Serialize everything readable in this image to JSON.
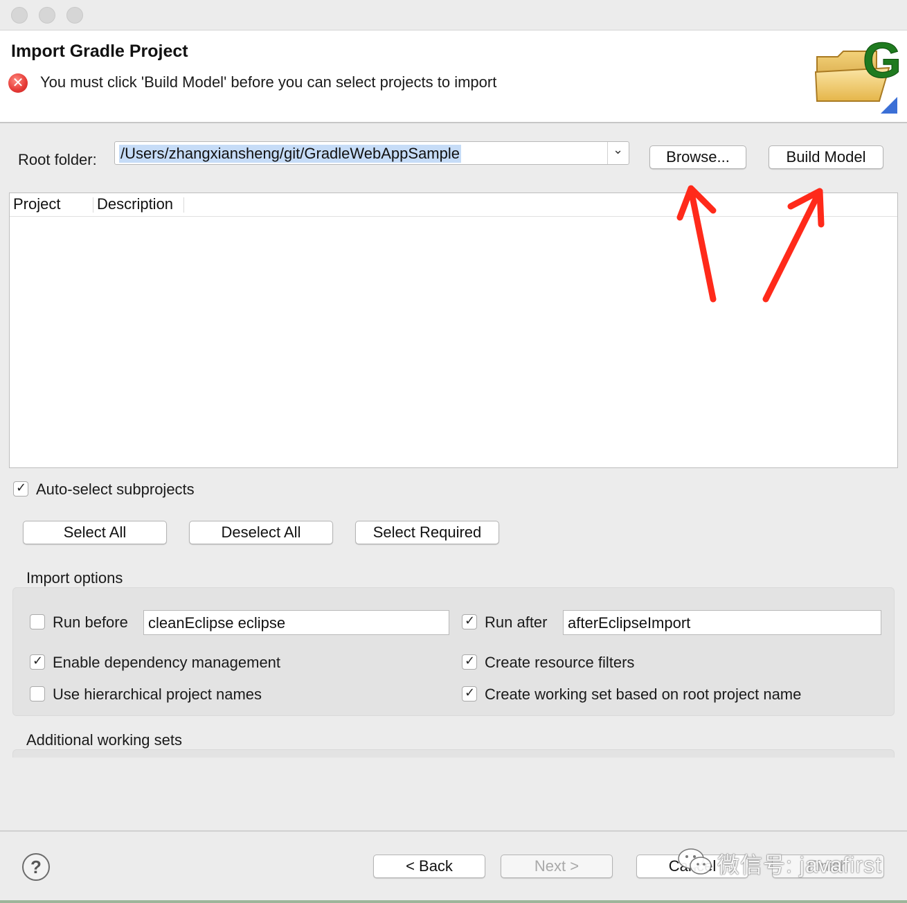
{
  "window": {
    "traffic_lights": [
      "close",
      "minimize",
      "zoom"
    ]
  },
  "header": {
    "title": "Import Gradle Project",
    "error_message": "You must click 'Build Model' before you can select projects to import",
    "wizard_icon_letter": "G"
  },
  "root_folder": {
    "label": "Root folder:",
    "value": "/Users/zhangxiansheng/git/GradleWebAppSample",
    "browse_label": "Browse...",
    "build_model_label": "Build Model"
  },
  "table": {
    "columns": [
      "Project",
      "Description"
    ],
    "rows": []
  },
  "auto_select": {
    "label": "Auto-select subprojects",
    "checked": true
  },
  "selection_buttons": {
    "select_all": "Select All",
    "deselect_all": "Deselect All",
    "select_required": "Select Required"
  },
  "import_options": {
    "title": "Import options",
    "run_before": {
      "label": "Run before",
      "checked": false,
      "value": "cleanEclipse eclipse"
    },
    "run_after": {
      "label": "Run after",
      "checked": true,
      "value": "afterEclipseImport"
    },
    "enable_dependency": {
      "label": "Enable dependency management",
      "checked": true
    },
    "resource_filters": {
      "label": "Create resource filters",
      "checked": true
    },
    "hierarchical_names": {
      "label": "Use hierarchical project names",
      "checked": false
    },
    "working_set_root": {
      "label": "Create working set based on root project name",
      "checked": true
    }
  },
  "additional_working_sets": {
    "title": "Additional working sets"
  },
  "footer": {
    "help_glyph": "?",
    "back_label": "< Back",
    "next_label": "Next >",
    "cancel_label": "Cancel",
    "finish_label": "Finish"
  },
  "watermark": {
    "text": "微信号: javafirst"
  },
  "colors": {
    "error_red": "#e53935",
    "annotation_arrow": "#ff2a1a",
    "selection_highlight": "#c6dcf7"
  }
}
